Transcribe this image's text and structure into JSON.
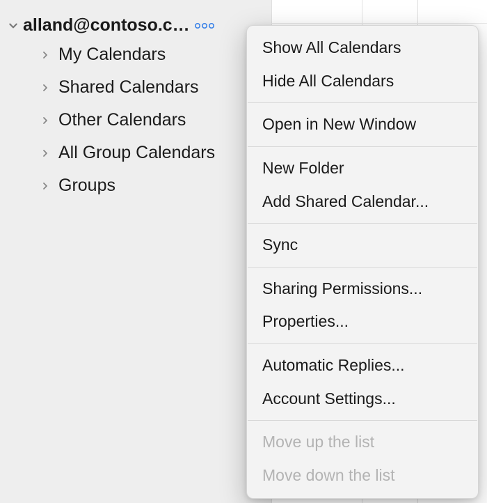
{
  "account": {
    "email_display": "alland@contoso.c…"
  },
  "sidebar": {
    "items": [
      {
        "label": "My Calendars"
      },
      {
        "label": "Shared Calendars"
      },
      {
        "label": "Other Calendars"
      },
      {
        "label": "All Group Calendars"
      },
      {
        "label": "Groups"
      }
    ]
  },
  "menu": {
    "show_all": "Show All Calendars",
    "hide_all": "Hide All Calendars",
    "open_new_window": "Open in New Window",
    "new_folder": "New Folder",
    "add_shared": "Add Shared Calendar...",
    "sync": "Sync",
    "sharing_permissions": "Sharing Permissions...",
    "properties": "Properties...",
    "automatic_replies": "Automatic Replies...",
    "account_settings": "Account Settings...",
    "move_up": "Move up the list",
    "move_down": "Move down the list"
  }
}
